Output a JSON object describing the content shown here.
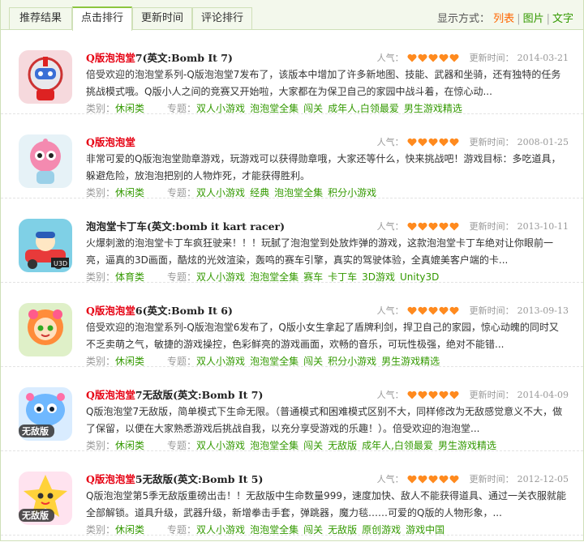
{
  "tabs": [
    {
      "label": "推荐结果",
      "active": false
    },
    {
      "label": "点击排行",
      "active": true
    },
    {
      "label": "更新时间",
      "active": false
    },
    {
      "label": "评论排行",
      "active": false
    }
  ],
  "view_mode": {
    "label": "显示方式：",
    "list": "列表",
    "image": "图片",
    "text": "文字",
    "selected": "列表"
  },
  "labels": {
    "popularity": "人气：",
    "updated": "更新时间：",
    "category": "类别：",
    "topic": "专题："
  },
  "colors": {
    "accent_green": "#339900",
    "title_red": "#e60012",
    "active_orange": "#ff6600",
    "heart": "#ff8a1e"
  },
  "items": [
    {
      "title_red": "Q版泡泡堂",
      "title_rest": "7(英文:Bomb It 7)",
      "hearts": 5,
      "date": "2014-03-21",
      "desc": "倍受欢迎的泡泡堂系列-Q版泡泡堂7发布了，该版本中增加了许多新地图、技能、武器和坐骑，还有独特的任务挑战模式哦。Q版小人之间的竞赛又开始啦，大家都在为保卫自己的家园中战斗着，在惊心动...",
      "category": "休闲类",
      "topics": [
        "双人小游戏",
        "泡泡堂全集",
        "闯关",
        "成年人,白领最爱",
        "男生游戏精选"
      ],
      "icon": "robot-icon"
    },
    {
      "title_red": "Q版泡泡堂",
      "title_rest": "",
      "hearts": 5,
      "date": "2008-01-25",
      "desc": "非常可爱的Q版泡泡堂勋章游戏，玩游戏可以获得勋章哦，大家还等什么，快来挑战吧！游戏目标：多吃道具，躲避危险，放泡泡把别的人物炸死，才能获得胜利。",
      "category": "休闲类",
      "topics": [
        "双人小游戏",
        "经典",
        "泡泡堂全集",
        "积分小游戏"
      ],
      "icon": "pink-robot-icon"
    },
    {
      "title_red": "",
      "title_rest": "泡泡堂卡丁车(英文:bomb it kart racer)",
      "hearts": 5,
      "date": "2013-10-11",
      "desc": "火爆刺激的泡泡堂卡丁车疯狂驶来！！！玩腻了泡泡堂到处放炸弹的游戏，这款泡泡堂卡丁车绝对让你眼前一亮，逼真的3D画面，酷炫的光效渲染，轰鸣的赛车引擎，真实的驾驶体验，全真媲美客户端的卡...",
      "category": "体育类",
      "topics": [
        "双人小游戏",
        "泡泡堂全集",
        "赛车",
        "卡丁车",
        "3D游戏",
        "Unity3D"
      ],
      "icon": "kart-icon"
    },
    {
      "title_red": "Q版泡泡堂",
      "title_rest": "6(英文:Bomb It 6)",
      "hearts": 5,
      "date": "2013-09-13",
      "desc": "倍受欢迎的泡泡堂系列-Q版泡泡堂6发布了，Q版小女生拿起了盾牌利剑，捍卫自己的家园，惊心动魄的同时又不乏卖萌之气，敏捷的游戏操控，色彩鲜亮的游戏画面，欢畅的音乐，可玩性极强，绝对不能错...",
      "category": "休闲类",
      "topics": [
        "双人小游戏",
        "泡泡堂全集",
        "闯关",
        "积分小游戏",
        "男生游戏精选"
      ],
      "icon": "flower-girl-icon"
    },
    {
      "title_red": "Q版泡泡堂",
      "title_rest": "7无敌版(英文:Bomb It 7)",
      "hearts": 5,
      "date": "2014-04-09",
      "desc": "Q版泡泡堂7无敌版，简单模式下生命无限。（普通模式和困难模式区别不大，同样修改为无敌感觉意义不大，做了保留，以便在大家熟悉游戏后挑战自我，以充分享受游戏的乐趣！）。倍受欢迎的泡泡堂...",
      "category": "休闲类",
      "topics": [
        "双人小游戏",
        "泡泡堂全集",
        "闯关",
        "无敌版",
        "成年人,白领最爱",
        "男生游戏精选"
      ],
      "icon": "blue-monster-icon",
      "badge": "无敌版"
    },
    {
      "title_red": "Q版泡泡堂",
      "title_rest": "5无敌版(英文:Bomb It 5)",
      "hearts": 5,
      "date": "2012-12-05",
      "desc": "Q版泡泡堂第5季无敌版重磅出击！！无敌版中生命数量999，速度加快、敌人不能获得道具、通过一关衣服就能全部解锁。道具升级，武器升级，新增拳击手套，弹跳器，魔力毯……可爱的Q版的人物形象，...",
      "category": "休闲类",
      "topics": [
        "双人小游戏",
        "泡泡堂全集",
        "闯关",
        "无敌版",
        "原创游戏",
        "游戏中国"
      ],
      "icon": "pink-star-icon",
      "badge": "无敌版"
    }
  ]
}
